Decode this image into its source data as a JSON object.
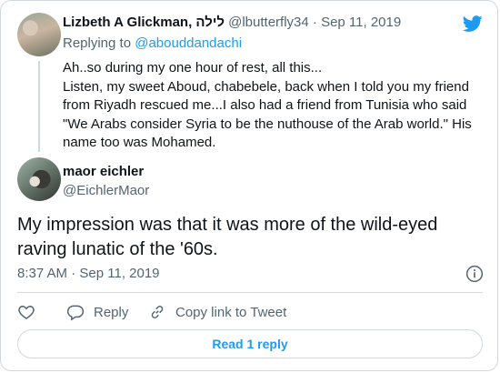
{
  "parent_tweet": {
    "author_name": "Lizbeth A Glickman, לילה",
    "handle": "@lbutterfly34",
    "separator": "·",
    "date": "Sep 11, 2019",
    "replying_label": "Replying to",
    "replying_handle": "@abouddandachi",
    "lines": [
      "Ah..so during my one hour of rest, all this...",
      "Listen, my sweet Aboud, chabebele, back when I told you my friend",
      "from Riyadh rescued me...I also had a friend from Tunisia who said",
      "\"We Arabs consider Syria to be the nuthouse of the Arab world.\" His",
      "name too was Mohamed."
    ]
  },
  "main_tweet": {
    "author_name": "maor eichler",
    "handle": "@EichlerMaor",
    "text_line1": "My impression was that it was more of the wild-eyed",
    "text_line2": "raving lunatic of the '60s.",
    "time": "8:37 AM",
    "separator": "·",
    "date": "Sep 11, 2019"
  },
  "actions": {
    "reply_label": "Reply",
    "copy_label": "Copy link to Tweet"
  },
  "read_replies_label": "Read 1 reply",
  "colors": {
    "accent": "#1d9bf0",
    "secondary_text": "#536471",
    "border": "#cfd9de"
  },
  "icons": [
    "twitter-bird-icon",
    "info-icon",
    "heart-icon",
    "reply-icon",
    "link-icon"
  ]
}
